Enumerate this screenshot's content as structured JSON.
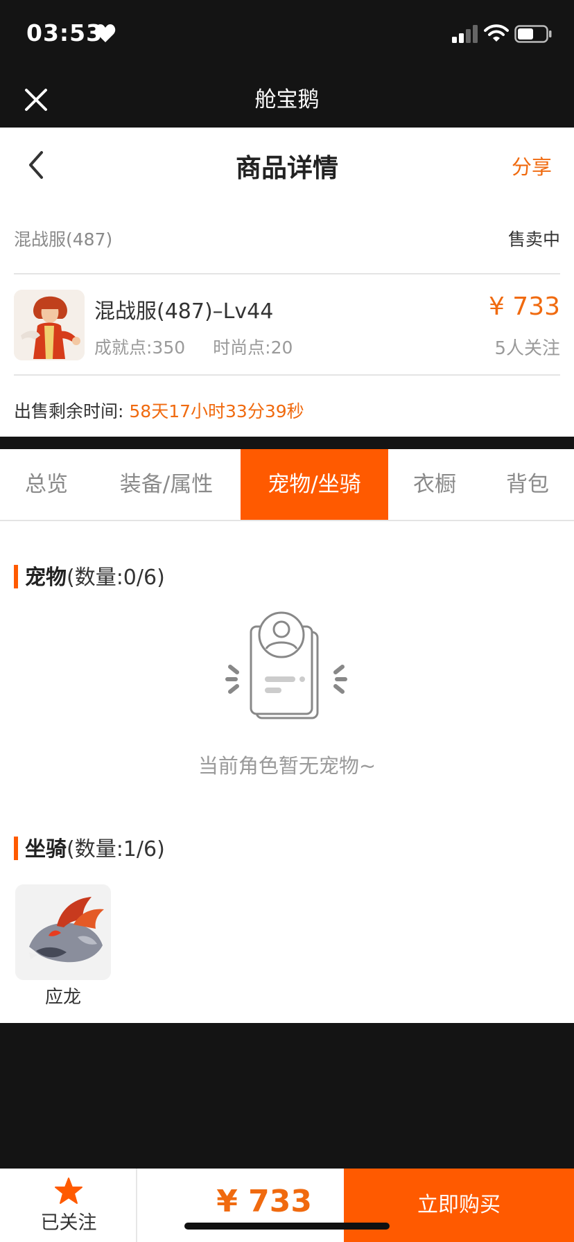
{
  "status_bar": {
    "time": "03:53"
  },
  "app_bar": {
    "title": "舱宝鹅"
  },
  "header": {
    "title": "商品详情",
    "share_label": "分享"
  },
  "listing": {
    "server": "混战服(487)",
    "status": "售卖中",
    "item_title": "混战服(487)–Lv44",
    "achievement": "成就点:350",
    "fashion": "时尚点:20",
    "price": "¥ 733",
    "followers": "5人关注",
    "remaining_label": "出售剩余时间:",
    "remaining_value": "58天17小时33分39秒"
  },
  "tabs": [
    {
      "label": "总览",
      "active": false
    },
    {
      "label": "装备/属性",
      "active": false
    },
    {
      "label": "宠物/坐骑",
      "active": true
    },
    {
      "label": "衣橱",
      "active": false
    },
    {
      "label": "背包",
      "active": false
    }
  ],
  "pets": {
    "title": "宠物",
    "count": "(数量:0/6)",
    "empty_text": "当前角色暂无宠物~"
  },
  "mounts": {
    "title": "坐骑",
    "count": "(数量:1/6)",
    "items": [
      {
        "name": "应龙"
      }
    ]
  },
  "bottom_bar": {
    "follow_label": "已关注",
    "price": "¥ 733",
    "buy_label": "立即购买"
  },
  "colors": {
    "accent": "#ff5a00",
    "price": "#f06a0f",
    "dark_bg": "#141414"
  },
  "icons": [
    "heart-icon",
    "signal-icon",
    "wifi-icon",
    "battery-icon",
    "close-icon",
    "back-icon",
    "star-icon"
  ]
}
